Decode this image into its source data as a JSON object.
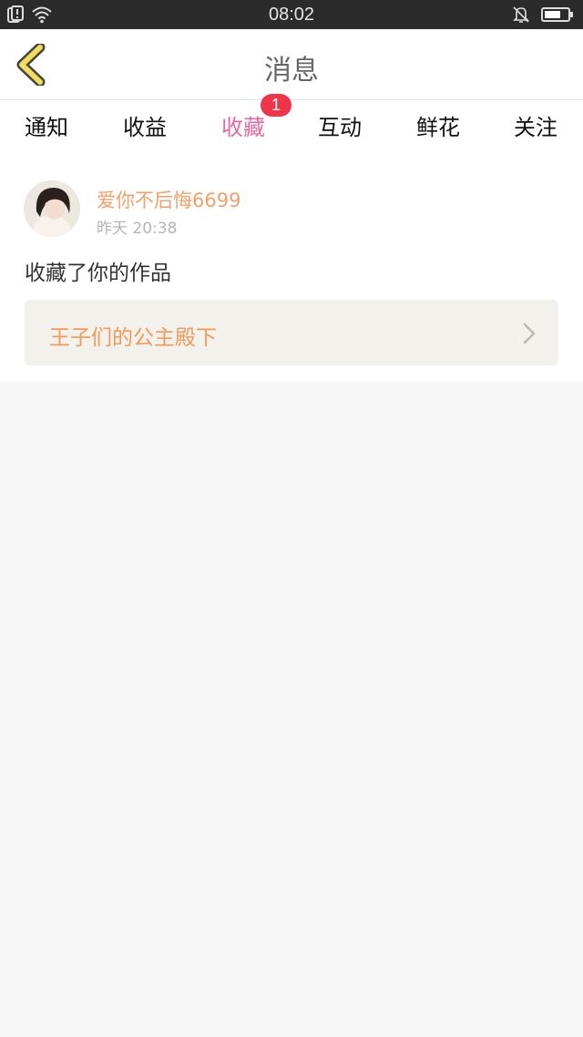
{
  "status_bar": {
    "time": "08:02",
    "icons": [
      "sim-alert-icon",
      "wifi-icon",
      "bell-muted-icon",
      "battery-icon"
    ]
  },
  "header": {
    "back_icon": "chevron-left-icon",
    "title": "消息"
  },
  "tabs": {
    "items": [
      {
        "label": "通知"
      },
      {
        "label": "收益"
      },
      {
        "label": "收藏",
        "active": true,
        "badge": "1"
      },
      {
        "label": "互动"
      },
      {
        "label": "鲜花"
      },
      {
        "label": "关注"
      }
    ],
    "accent_color": "#e46aa0",
    "badge_color": "#f0344a"
  },
  "message": {
    "username": "爱你不后悔6699",
    "timestamp": "昨天 20:38",
    "action": "收藏了你的作品",
    "work_title": "王子们的公主殿下",
    "work_arrow_icon": "chevron-right-icon",
    "username_color": "#f2a06a"
  }
}
